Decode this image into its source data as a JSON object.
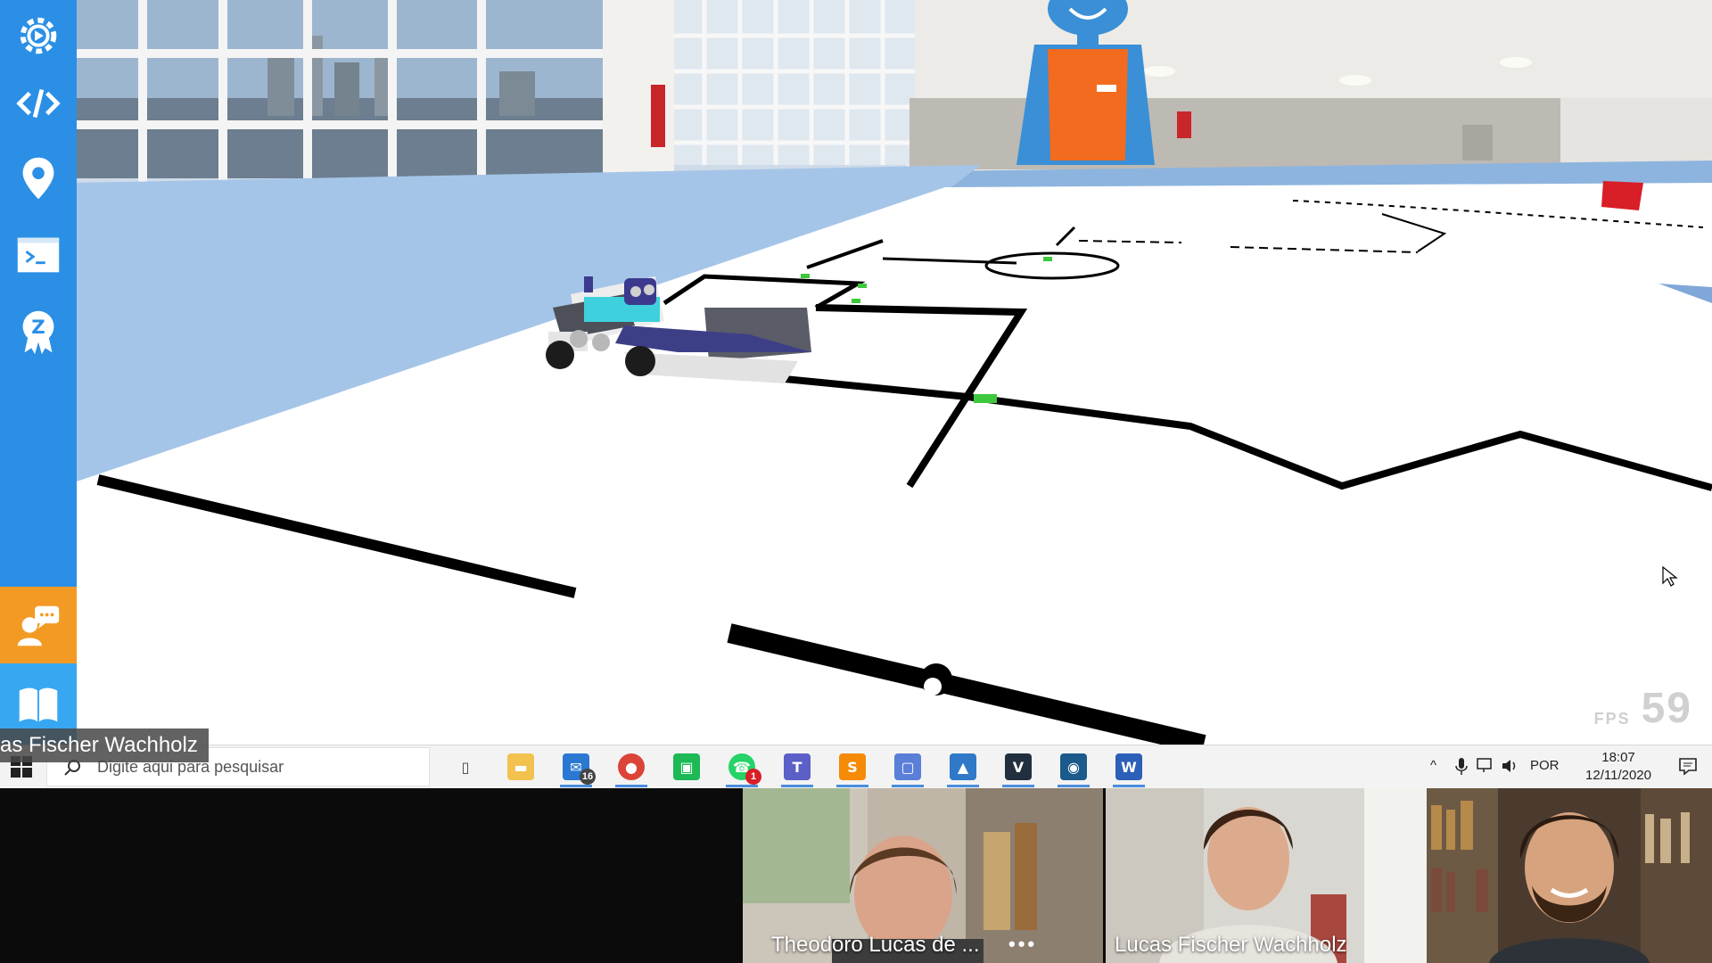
{
  "sidebar": {
    "items": [
      {
        "icon": "gear-icon"
      },
      {
        "icon": "code-icon"
      },
      {
        "icon": "location-pin-icon"
      },
      {
        "icon": "terminal-icon"
      },
      {
        "icon": "badge-z-icon"
      },
      {
        "icon": "chat-support-icon"
      },
      {
        "icon": "book-icon"
      }
    ]
  },
  "presenter_name": "cas Fischer Wachholz",
  "fps": {
    "label": "FPS",
    "value": "59"
  },
  "taskbar": {
    "search_placeholder": "Digite aqui para pesquisar",
    "apps": [
      {
        "name": "task-view",
        "glyph": "▯",
        "color": "#555555"
      },
      {
        "name": "file-explorer",
        "glyph": "▬",
        "color": "#f2c14e"
      },
      {
        "name": "mail",
        "glyph": "✉",
        "color": "#2a78d2",
        "badge": "16"
      },
      {
        "name": "chrome",
        "glyph": "●",
        "color": "#db4437"
      },
      {
        "name": "spotify-like",
        "glyph": "▣",
        "color": "#1db954"
      },
      {
        "name": "whatsapp",
        "glyph": "☎",
        "color": "#25d366",
        "badge": "1"
      },
      {
        "name": "teams",
        "glyph": "T",
        "color": "#5b5fc7"
      },
      {
        "name": "sublime",
        "glyph": "S",
        "color": "#f58a07"
      },
      {
        "name": "screen-capture",
        "glyph": "▢",
        "color": "#5a7fd8"
      },
      {
        "name": "photos",
        "glyph": "▲",
        "color": "#2f79c8"
      },
      {
        "name": "vs",
        "glyph": "V",
        "color": "#222f3e"
      },
      {
        "name": "robot-app",
        "glyph": "◉",
        "color": "#1b5a8a"
      },
      {
        "name": "word",
        "glyph": "W",
        "color": "#2b5fb8"
      }
    ],
    "tray": {
      "language": "POR",
      "time": "18:07",
      "date": "12/11/2020"
    }
  },
  "call": {
    "participants": [
      {
        "name": "Theodoro Lucas de ..."
      },
      {
        "name": "Lucas Fischer Wachholz"
      },
      {
        "name": ""
      }
    ],
    "more": "•••"
  },
  "colors": {
    "sidebar": "#2b8fe6",
    "sidebar_orange": "#f39a25",
    "taskbar": "#f3f3f3"
  }
}
